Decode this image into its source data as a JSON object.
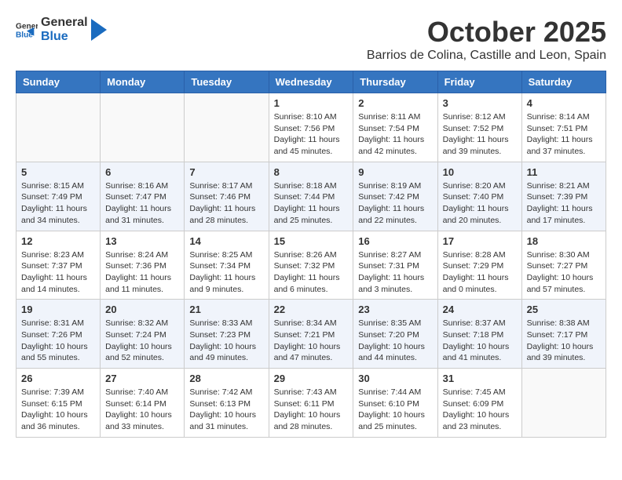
{
  "logo": {
    "general": "General",
    "blue": "Blue"
  },
  "title": "October 2025",
  "location": "Barrios de Colina, Castille and Leon, Spain",
  "days": [
    "Sunday",
    "Monday",
    "Tuesday",
    "Wednesday",
    "Thursday",
    "Friday",
    "Saturday"
  ],
  "weeks": [
    [
      {
        "day": "",
        "info": ""
      },
      {
        "day": "",
        "info": ""
      },
      {
        "day": "",
        "info": ""
      },
      {
        "day": "1",
        "info": "Sunrise: 8:10 AM\nSunset: 7:56 PM\nDaylight: 11 hours and 45 minutes."
      },
      {
        "day": "2",
        "info": "Sunrise: 8:11 AM\nSunset: 7:54 PM\nDaylight: 11 hours and 42 minutes."
      },
      {
        "day": "3",
        "info": "Sunrise: 8:12 AM\nSunset: 7:52 PM\nDaylight: 11 hours and 39 minutes."
      },
      {
        "day": "4",
        "info": "Sunrise: 8:14 AM\nSunset: 7:51 PM\nDaylight: 11 hours and 37 minutes."
      }
    ],
    [
      {
        "day": "5",
        "info": "Sunrise: 8:15 AM\nSunset: 7:49 PM\nDaylight: 11 hours and 34 minutes."
      },
      {
        "day": "6",
        "info": "Sunrise: 8:16 AM\nSunset: 7:47 PM\nDaylight: 11 hours and 31 minutes."
      },
      {
        "day": "7",
        "info": "Sunrise: 8:17 AM\nSunset: 7:46 PM\nDaylight: 11 hours and 28 minutes."
      },
      {
        "day": "8",
        "info": "Sunrise: 8:18 AM\nSunset: 7:44 PM\nDaylight: 11 hours and 25 minutes."
      },
      {
        "day": "9",
        "info": "Sunrise: 8:19 AM\nSunset: 7:42 PM\nDaylight: 11 hours and 22 minutes."
      },
      {
        "day": "10",
        "info": "Sunrise: 8:20 AM\nSunset: 7:40 PM\nDaylight: 11 hours and 20 minutes."
      },
      {
        "day": "11",
        "info": "Sunrise: 8:21 AM\nSunset: 7:39 PM\nDaylight: 11 hours and 17 minutes."
      }
    ],
    [
      {
        "day": "12",
        "info": "Sunrise: 8:23 AM\nSunset: 7:37 PM\nDaylight: 11 hours and 14 minutes."
      },
      {
        "day": "13",
        "info": "Sunrise: 8:24 AM\nSunset: 7:36 PM\nDaylight: 11 hours and 11 minutes."
      },
      {
        "day": "14",
        "info": "Sunrise: 8:25 AM\nSunset: 7:34 PM\nDaylight: 11 hours and 9 minutes."
      },
      {
        "day": "15",
        "info": "Sunrise: 8:26 AM\nSunset: 7:32 PM\nDaylight: 11 hours and 6 minutes."
      },
      {
        "day": "16",
        "info": "Sunrise: 8:27 AM\nSunset: 7:31 PM\nDaylight: 11 hours and 3 minutes."
      },
      {
        "day": "17",
        "info": "Sunrise: 8:28 AM\nSunset: 7:29 PM\nDaylight: 11 hours and 0 minutes."
      },
      {
        "day": "18",
        "info": "Sunrise: 8:30 AM\nSunset: 7:27 PM\nDaylight: 10 hours and 57 minutes."
      }
    ],
    [
      {
        "day": "19",
        "info": "Sunrise: 8:31 AM\nSunset: 7:26 PM\nDaylight: 10 hours and 55 minutes."
      },
      {
        "day": "20",
        "info": "Sunrise: 8:32 AM\nSunset: 7:24 PM\nDaylight: 10 hours and 52 minutes."
      },
      {
        "day": "21",
        "info": "Sunrise: 8:33 AM\nSunset: 7:23 PM\nDaylight: 10 hours and 49 minutes."
      },
      {
        "day": "22",
        "info": "Sunrise: 8:34 AM\nSunset: 7:21 PM\nDaylight: 10 hours and 47 minutes."
      },
      {
        "day": "23",
        "info": "Sunrise: 8:35 AM\nSunset: 7:20 PM\nDaylight: 10 hours and 44 minutes."
      },
      {
        "day": "24",
        "info": "Sunrise: 8:37 AM\nSunset: 7:18 PM\nDaylight: 10 hours and 41 minutes."
      },
      {
        "day": "25",
        "info": "Sunrise: 8:38 AM\nSunset: 7:17 PM\nDaylight: 10 hours and 39 minutes."
      }
    ],
    [
      {
        "day": "26",
        "info": "Sunrise: 7:39 AM\nSunset: 6:15 PM\nDaylight: 10 hours and 36 minutes."
      },
      {
        "day": "27",
        "info": "Sunrise: 7:40 AM\nSunset: 6:14 PM\nDaylight: 10 hours and 33 minutes."
      },
      {
        "day": "28",
        "info": "Sunrise: 7:42 AM\nSunset: 6:13 PM\nDaylight: 10 hours and 31 minutes."
      },
      {
        "day": "29",
        "info": "Sunrise: 7:43 AM\nSunset: 6:11 PM\nDaylight: 10 hours and 28 minutes."
      },
      {
        "day": "30",
        "info": "Sunrise: 7:44 AM\nSunset: 6:10 PM\nDaylight: 10 hours and 25 minutes."
      },
      {
        "day": "31",
        "info": "Sunrise: 7:45 AM\nSunset: 6:09 PM\nDaylight: 10 hours and 23 minutes."
      },
      {
        "day": "",
        "info": ""
      }
    ]
  ]
}
